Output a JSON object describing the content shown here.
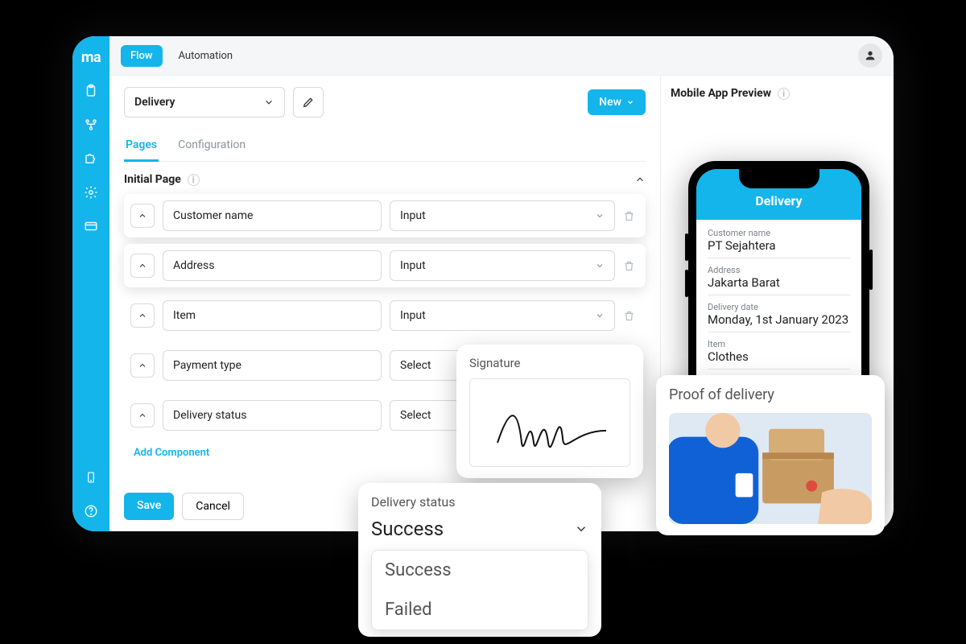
{
  "brand": "ma",
  "topbar": {
    "tab_flow": "Flow",
    "tab_automation": "Automation"
  },
  "builder": {
    "flow_name": "Delivery",
    "new_label": "New",
    "subtabs": {
      "pages": "Pages",
      "configuration": "Configuration"
    },
    "section_title": "Initial Page",
    "rows": [
      {
        "label": "Customer name",
        "type": "Input"
      },
      {
        "label": "Address",
        "type": "Input"
      },
      {
        "label": "Item",
        "type": "Input"
      },
      {
        "label": "Payment type",
        "type": "Select"
      },
      {
        "label": "Delivery status",
        "type": "Select"
      }
    ],
    "add_component": "Add Component",
    "save": "Save",
    "cancel": "Cancel"
  },
  "preview": {
    "title": "Mobile App Preview",
    "screen_title": "Delivery",
    "fields": [
      {
        "label": "Customer name",
        "value": "PT Sejahtera"
      },
      {
        "label": "Address",
        "value": "Jakarta Barat"
      },
      {
        "label": "Delivery date",
        "value": "Monday, 1st January 2023"
      },
      {
        "label": "Item",
        "value": "Clothes"
      }
    ]
  },
  "float": {
    "signature": {
      "title": "Signature"
    },
    "proof": {
      "title": "Proof of delivery"
    },
    "status": {
      "title": "Delivery status",
      "selected": "Success",
      "options": [
        "Success",
        "Failed"
      ]
    }
  }
}
